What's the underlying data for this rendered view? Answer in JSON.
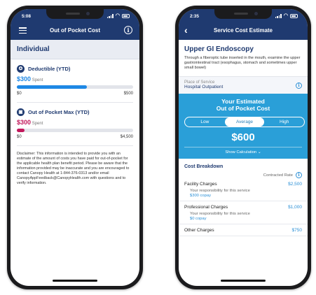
{
  "left": {
    "status_time": "5:08",
    "title": "Out of Pocket Cost",
    "section": "Individual",
    "meters": [
      {
        "label": "Deductible (YTD)",
        "icon": "shield-icon",
        "icon_glyph": "✪",
        "amount": "$300",
        "spent_label": "Spent",
        "color": "#1e88e5",
        "progress": 0.6,
        "min": "$0",
        "max": "$500"
      },
      {
        "label": "Out of Pocket Max (YTD)",
        "icon": "wallet-icon",
        "icon_glyph": "▣",
        "amount": "$300",
        "spent_label": "Spent",
        "color": "#c2185b",
        "progress": 0.067,
        "min": "$0",
        "max": "$4,500"
      }
    ],
    "disclaimer": "Disclaimer: This information is intended to provide you with an estimate of the amount of costs you have paid for out-of-pocket for the applicable health plan benefit period. Please be aware that the information provided may be inaccurate and you are encouraged to contact Canopy Health at 1-844-376-0313 and/or email CanopyAppFeedback@CanopyHealth.com with questions and to verify information."
  },
  "right": {
    "status_time": "2:35",
    "title": "Service Cost Estimate",
    "procedure": "Upper GI Endoscopy",
    "description": "Through a fiberoptic tube inserted in the mouth, examine the upper gastrointestinal tract (esophagus, stomach and sometimes upper small bowel)",
    "place_label": "Place of Service",
    "place_value": "Hospital Outpatient",
    "estimate_title_1": "Your Estimated",
    "estimate_title_2": "Out of Pocket Cost",
    "tabs": [
      "Low",
      "Average",
      "High"
    ],
    "selected_tab": "Average",
    "amount": "$600",
    "show_calc": "Show Calculation",
    "breakdown_title": "Cost Breakdown",
    "contracted_rate": "Contracted Rate",
    "charges": [
      {
        "name": "Facility Charges",
        "amount": "$2,500",
        "resp": "Your responsibility for this service",
        "copay": "$300 copay"
      },
      {
        "name": "Professional Charges",
        "amount": "$1,000",
        "resp": "Your responsibility for this service",
        "copay": "$0 copay"
      },
      {
        "name": "Other Charges",
        "amount": "$750"
      }
    ]
  }
}
